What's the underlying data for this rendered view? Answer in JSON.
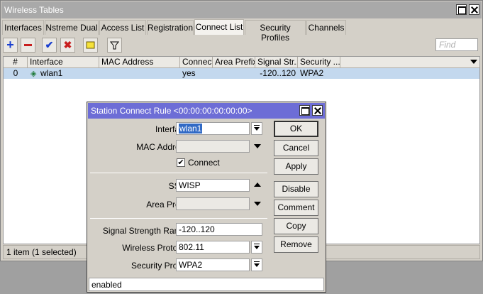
{
  "window": {
    "title": "Wireless Tables",
    "tabs": [
      "Interfaces",
      "Nstreme Dual",
      "Access List",
      "Registration",
      "Connect List",
      "Security Profiles",
      "Channels"
    ],
    "active_tab": "Connect List",
    "find_placeholder": "Find",
    "toolbar": [
      "add-icon",
      "remove-icon",
      "enable-icon",
      "disable-icon",
      "comment-icon",
      "filter-icon"
    ]
  },
  "table": {
    "columns": [
      "#",
      "Interface",
      "MAC Address",
      "Connect",
      "Area Prefix",
      "Signal Str...",
      "Security ..."
    ],
    "rows": [
      {
        "num": "0",
        "interface": "wlan1",
        "mac": "",
        "connect": "yes",
        "area_prefix": "",
        "signal": "-120..120",
        "security": "WPA2"
      }
    ],
    "status": "1 item (1 selected)"
  },
  "dialog": {
    "title": "Station Connect Rule <00:00:00:00:00:00>",
    "labels": {
      "interface": "Interface:",
      "mac": "MAC Address:",
      "connect": "Connect",
      "ssid": "SSID:",
      "area_prefix": "Area Prefix:",
      "signal": "Signal Strength Range:",
      "protocol": "Wireless Protocol:",
      "security": "Security Profile:"
    },
    "values": {
      "interface": "wlan1",
      "mac": "",
      "connect_checked": "✔",
      "ssid": "WISP",
      "area_prefix": "",
      "signal": "-120..120",
      "protocol": "802.11",
      "security": "WPA2"
    },
    "buttons": [
      "OK",
      "Cancel",
      "Apply",
      "Disable",
      "Comment",
      "Copy",
      "Remove"
    ],
    "status": "enabled"
  }
}
